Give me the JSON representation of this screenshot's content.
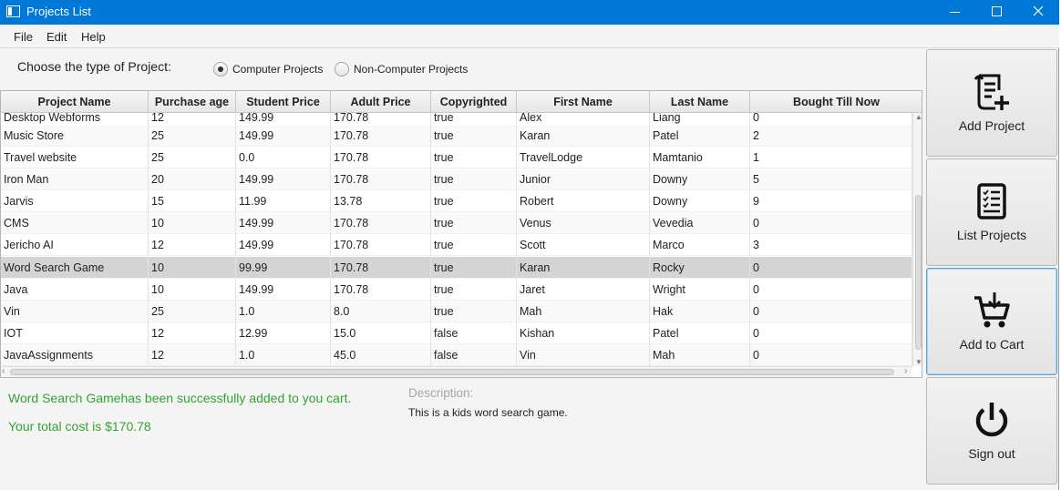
{
  "window": {
    "title": "Projects List"
  },
  "menu": [
    "File",
    "Edit",
    "Help"
  ],
  "project_type": {
    "prompt": "Choose the type of Project:",
    "options": [
      {
        "label": "Computer Projects",
        "selected": true
      },
      {
        "label": "Non-Computer Projects",
        "selected": false
      }
    ]
  },
  "table": {
    "columns": [
      "Project Name",
      "Purchase age",
      "Student Price",
      "Adult Price",
      "Copyrighted",
      "First Name",
      "Last Name",
      "Bought Till Now"
    ],
    "rows": [
      [
        "Desktop Webforms",
        "12",
        "149.99",
        "170.78",
        "true",
        "Alex",
        "Liang",
        "0"
      ],
      [
        "Music Store",
        "25",
        "149.99",
        "170.78",
        "true",
        "Karan",
        "Patel",
        "2"
      ],
      [
        "Travel website",
        "25",
        "0.0",
        "170.78",
        "true",
        "TravelLodge",
        "Mamtanio",
        "1"
      ],
      [
        "Iron Man",
        "20",
        "149.99",
        "170.78",
        "true",
        "Junior",
        "Downy",
        "5"
      ],
      [
        "Jarvis",
        "15",
        "11.99",
        "13.78",
        "true",
        "Robert",
        "Downy",
        "9"
      ],
      [
        "CMS",
        "10",
        "149.99",
        "170.78",
        "true",
        "Venus",
        "Vevedia",
        "0"
      ],
      [
        "Jericho AI",
        "12",
        "149.99",
        "170.78",
        "true",
        "Scott",
        "Marco",
        "3"
      ],
      [
        "Word Search Game",
        "10",
        "99.99",
        "170.78",
        "true",
        "Karan",
        "Rocky",
        "0"
      ],
      [
        "Java",
        "10",
        "149.99",
        "170.78",
        "true",
        "Jaret",
        "Wright",
        "0"
      ],
      [
        "Vin",
        "25",
        "1.0",
        "8.0",
        "true",
        "Mah",
        "Hak",
        "0"
      ],
      [
        "IOT",
        "12",
        "12.99",
        "15.0",
        "false",
        "Kishan",
        "Patel",
        "0"
      ],
      [
        "JavaAssignments",
        "12",
        "1.0",
        "45.0",
        "false",
        "Vin",
        "Mah",
        "0"
      ]
    ],
    "selected_row": "Word Search Game"
  },
  "status": {
    "added_message": "Word Search Gamehas been successfully added to you cart.",
    "total_message": "Your total cost is $170.78",
    "color": "#2ea52e"
  },
  "description": {
    "label": "Description:",
    "text": "This is a kids word search game."
  },
  "actions": [
    {
      "label": "Add Project",
      "icon": "add-document-icon"
    },
    {
      "label": "List Projects",
      "icon": "checklist-icon"
    },
    {
      "label": "Add to Cart",
      "icon": "cart-icon"
    },
    {
      "label": "Sign out",
      "icon": "power-icon"
    }
  ]
}
